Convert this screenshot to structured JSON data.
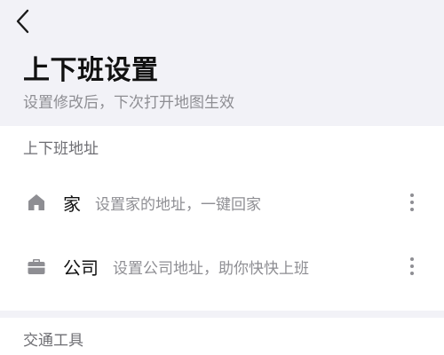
{
  "page": {
    "title": "上下班设置",
    "subtitle": "设置修改后，下次打开地图生效"
  },
  "address_section": {
    "title": "上下班地址",
    "items": [
      {
        "label": "家",
        "description": "设置家的地址，一键回家",
        "icon": "home-icon"
      },
      {
        "label": "公司",
        "description": "设置公司地址，助你快快上班",
        "icon": "briefcase-icon"
      }
    ]
  },
  "transport_section": {
    "title": "交通工具"
  },
  "colors": {
    "background": "#f2f2f7",
    "card": "#ffffff",
    "secondary_text": "#8e8e93",
    "icon": "#8e8e93"
  }
}
